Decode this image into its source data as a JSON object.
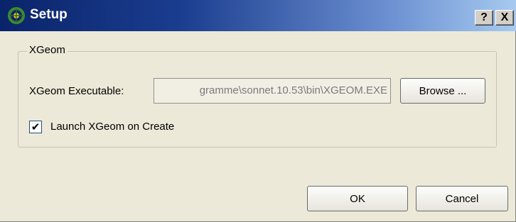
{
  "window": {
    "title": "Setup",
    "help_button": "?",
    "close_button": "X"
  },
  "group": {
    "label": "XGeom",
    "executable_label": "XGeom Executable:",
    "executable_value": "gramme\\sonnet.10.53\\bin\\XGEOM.EXE",
    "browse_label": "Browse ...",
    "launch_checkbox_label": "Launch XGeom on Create",
    "launch_checked": true,
    "check_glyph": "✔"
  },
  "actions": {
    "ok_label": "OK",
    "cancel_label": "Cancel"
  },
  "icons": {
    "app": "app-icon",
    "help": "help-icon",
    "close": "close-icon",
    "check": "check-icon"
  },
  "colors": {
    "titlebar_start": "#0a246a",
    "titlebar_end": "#a6caf0",
    "dialog_background": "#ece9d8"
  }
}
